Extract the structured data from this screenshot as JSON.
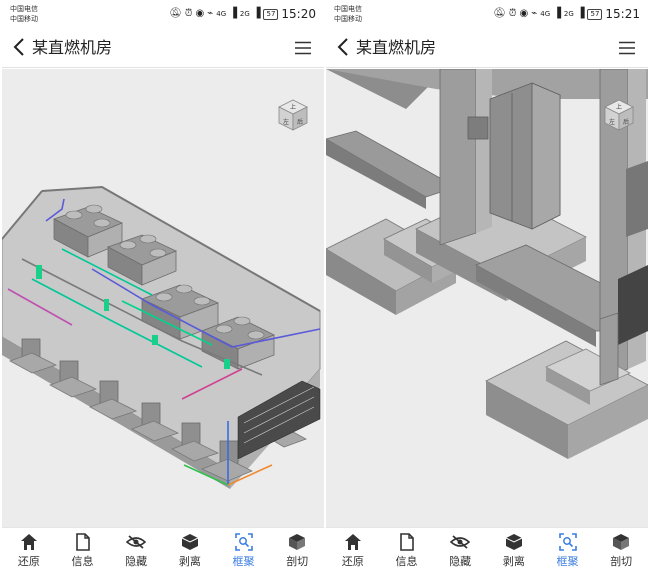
{
  "left": {
    "status": {
      "carrier_1": "中国电信",
      "carrier_2": "中国移动",
      "signal_gen": "4G",
      "signal_gen_2": "2G",
      "battery": "57",
      "time": "15:20"
    },
    "header": {
      "title": "某直燃机房"
    }
  },
  "right": {
    "status": {
      "carrier_1": "中国电信",
      "carrier_2": "中国移动",
      "signal_gen": "4G",
      "signal_gen_2": "2G",
      "battery": "57",
      "time": "15:21"
    },
    "header": {
      "title": "某直燃机房"
    }
  },
  "viewcube": {
    "top": "上",
    "front": "左",
    "side": "后"
  },
  "tabs": [
    {
      "label": "还原",
      "icon": "home-icon"
    },
    {
      "label": "信息",
      "icon": "document-icon"
    },
    {
      "label": "隐藏",
      "icon": "eye-off-icon"
    },
    {
      "label": "剥离",
      "icon": "peel-icon"
    },
    {
      "label": "框聚",
      "icon": "frame-focus-icon",
      "active": true
    },
    {
      "label": "剖切",
      "icon": "section-cut-icon"
    }
  ],
  "colors": {
    "accent": "#3a7de0",
    "viewport_bg": "#ececec",
    "model_gray": "#8c8c8c"
  }
}
